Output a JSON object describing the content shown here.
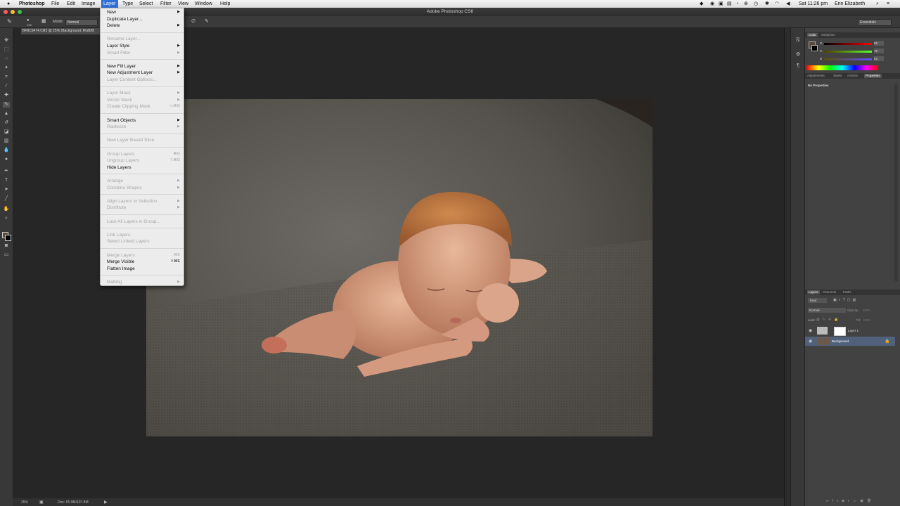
{
  "menubar": {
    "apple": "",
    "items": [
      "Photoshop",
      "File",
      "Edit",
      "Image",
      "Layer",
      "Type",
      "Select",
      "Filter",
      "View",
      "Window",
      "Help"
    ],
    "active": "Layer",
    "clock": "Sat 11:26 pm",
    "user": "Erin Elizabeth"
  },
  "window": {
    "title": "Adobe Photoshop CS6"
  },
  "options": {
    "mode_label": "Mode:",
    "mode_value": "Normal",
    "brush_size": "125",
    "workspace": "Essentials"
  },
  "document": {
    "tab": "BF8C9474.CR2 @ 25% (Background, RGB/8)"
  },
  "status": {
    "zoom": "25%",
    "doc": "Doc: 65.9M/107.8M"
  },
  "layer_menu": {
    "items": [
      {
        "label": "New",
        "submenu": true,
        "disabled": false
      },
      {
        "label": "Duplicate Layer...",
        "disabled": false
      },
      {
        "label": "Delete",
        "submenu": true,
        "disabled": false
      },
      {
        "sep": true
      },
      {
        "label": "Rename Layer...",
        "disabled": true
      },
      {
        "label": "Layer Style",
        "submenu": true,
        "disabled": false
      },
      {
        "label": "Smart Filter",
        "submenu": true,
        "disabled": true
      },
      {
        "sep": true
      },
      {
        "label": "New Fill Layer",
        "submenu": true,
        "disabled": false
      },
      {
        "label": "New Adjustment Layer",
        "submenu": true,
        "disabled": false
      },
      {
        "label": "Layer Content Options...",
        "disabled": true
      },
      {
        "sep": true
      },
      {
        "label": "Layer Mask",
        "submenu": true,
        "disabled": true
      },
      {
        "label": "Vector Mask",
        "submenu": true,
        "disabled": true
      },
      {
        "label": "Create Clipping Mask",
        "shortcut": "⌥⌘G",
        "disabled": true
      },
      {
        "sep": true
      },
      {
        "label": "Smart Objects",
        "submenu": true,
        "disabled": false
      },
      {
        "label": "Rasterize",
        "submenu": true,
        "disabled": true
      },
      {
        "sep": true
      },
      {
        "label": "New Layer Based Slice",
        "disabled": true
      },
      {
        "sep": true
      },
      {
        "label": "Group Layers",
        "shortcut": "⌘G",
        "disabled": true
      },
      {
        "label": "Ungroup Layers",
        "shortcut": "⇧⌘G",
        "disabled": true
      },
      {
        "label": "Hide Layers",
        "disabled": false
      },
      {
        "sep": true
      },
      {
        "label": "Arrange",
        "submenu": true,
        "disabled": true
      },
      {
        "label": "Combine Shapes",
        "submenu": true,
        "disabled": true
      },
      {
        "sep": true
      },
      {
        "label": "Align Layers to Selection",
        "submenu": true,
        "disabled": true
      },
      {
        "label": "Distribute",
        "submenu": true,
        "disabled": true
      },
      {
        "sep": true
      },
      {
        "label": "Lock All Layers in Group...",
        "disabled": true
      },
      {
        "sep": true
      },
      {
        "label": "Link Layers",
        "disabled": true
      },
      {
        "label": "Select Linked Layers",
        "disabled": true
      },
      {
        "sep": true
      },
      {
        "label": "Merge Layers",
        "shortcut": "⌘E",
        "disabled": true
      },
      {
        "label": "Merge Visible",
        "shortcut": "⇧⌘E",
        "disabled": false
      },
      {
        "label": "Flatten Image",
        "disabled": false
      },
      {
        "sep": true
      },
      {
        "label": "Matting",
        "submenu": true,
        "disabled": true
      }
    ]
  },
  "color_panel": {
    "tabs": [
      "Color",
      "Swatches"
    ],
    "r": "86",
    "g": "79",
    "b": "62",
    "r_label": "R",
    "g_label": "G",
    "b_label": "B"
  },
  "properties_panel": {
    "tabs": [
      "Adjustments",
      "Styles",
      "Actions",
      "Properties"
    ],
    "message": "No Properties"
  },
  "layers_panel": {
    "tabs": [
      "Layers",
      "Channels",
      "Paths"
    ],
    "kind": "Kind",
    "blend": "Normal",
    "opacity_label": "Opacity:",
    "opacity": "100%",
    "lock_label": "Lock:",
    "fill_label": "Fill:",
    "fill": "100%",
    "layers": [
      {
        "name": "Layer 1",
        "selected": false
      },
      {
        "name": "Background",
        "selected": true
      }
    ]
  },
  "colors": {
    "menu_highlight": "#2f6fd6",
    "layer_selected": "#51617c"
  }
}
